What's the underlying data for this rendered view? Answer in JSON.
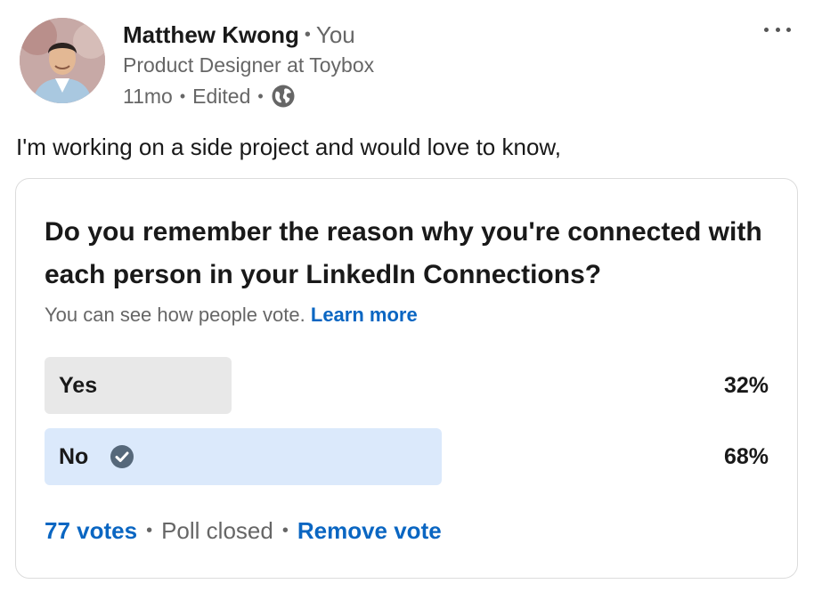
{
  "post": {
    "author": {
      "name": "Matthew Kwong",
      "relation": "You",
      "headline": "Product Designer at Toybox",
      "age": "11mo",
      "edited": "Edited",
      "visibility_icon": "globe-icon"
    },
    "text": "I'm working on a side project and would love to know,"
  },
  "poll": {
    "question": "Do you remember the reason why you're connected with each person in your LinkedIn Connections?",
    "visibility_note": "You can see how people vote.",
    "learn_more": "Learn more",
    "options": [
      {
        "label": "Yes",
        "percent_text": "32%",
        "percent": 32,
        "selected": false
      },
      {
        "label": "No",
        "percent_text": "68%",
        "percent": 68,
        "selected": true
      }
    ],
    "votes": "77 votes",
    "status": "Poll closed",
    "remove_vote": "Remove vote"
  },
  "colors": {
    "accent": "#0a66c2",
    "option_bar": "#e8e8e8",
    "selected_bar": "#dbe9fb"
  }
}
